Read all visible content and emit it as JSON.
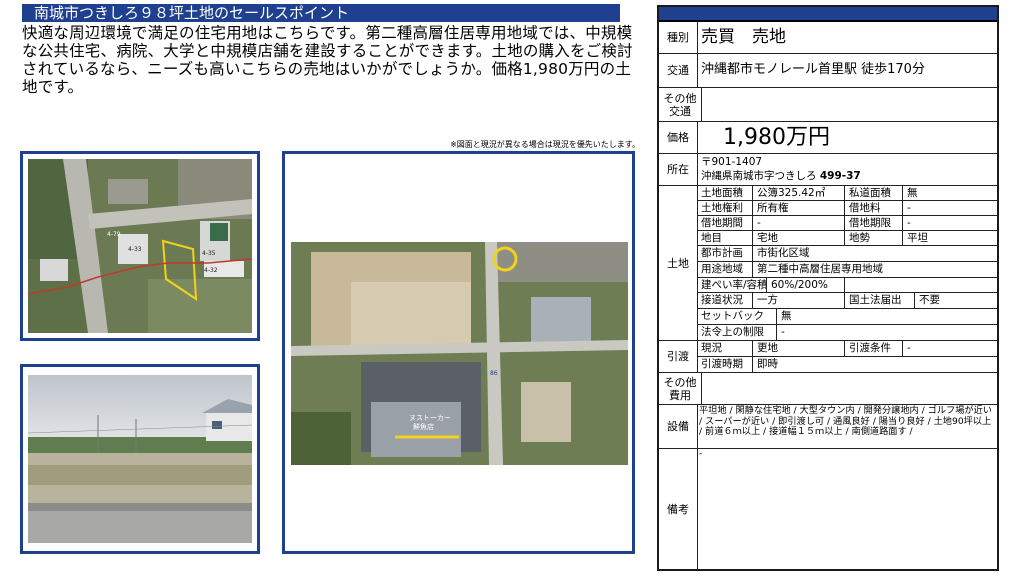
{
  "header": {
    "title": "南城市つきしろ９８坪土地のセールスポイント"
  },
  "description": "快適な周辺環境で満足の住宅用地はこちらです。第二種高層住居専用地域では、中規模な公共住宅、病院、大学と中規模店舗を建設することができます。土地の購入をご検討されているなら、ニーズも高いこちらの売地はいかがでしょうか。価格1,980万円の土地です。",
  "notice": "※図面と現況が異なる場合は現況を優先いたします。",
  "images": {
    "map_labels": [
      "4-79",
      "4-33",
      "4-35",
      "4-32"
    ],
    "aerial_labels": [
      "ヌストーカー",
      "鮮魚店"
    ],
    "aerial_road_number": "86"
  },
  "spec": {
    "type_label": "種別",
    "type_value": "売買　売地",
    "transport_label": "交通",
    "transport_value": "沖縄都市モノレール首里駅 徒歩170分",
    "other_transport_label": "その他交通",
    "other_transport_value": "",
    "price_label": "価格",
    "price_value": "1,980万円",
    "address_label": "所在",
    "postal": "〒901-1407",
    "address": "沖縄県南城市字つきしろ",
    "address_number": "499-37",
    "land_label": "土地",
    "land_area_label": "土地面積",
    "land_area_value": "公簿325.42㎡",
    "private_road_label": "私道面積",
    "private_road_value": "無",
    "land_right_label": "土地権利",
    "land_right_value": "所有権",
    "lease_fee_label": "借地料",
    "lease_fee_value": "-",
    "lease_period_label": "借地期間",
    "lease_period_value": "-",
    "lease_limit_label": "借地期限",
    "lease_limit_value": "-",
    "category_label": "地目",
    "category_value": "宅地",
    "terrain_label": "地勢",
    "terrain_value": "平坦",
    "city_plan_label": "都市計画",
    "city_plan_value": "市街化区域",
    "zoning_label": "用途地域",
    "zoning_value": "第二種中高層住居専用地域",
    "ratio_label": "建ぺい率/容積率",
    "ratio_value": "60%/200%",
    "road_label": "接道状況",
    "road_value": "一方",
    "notification_label": "国土法届出",
    "notification_value": "不要",
    "setback_label": "セットバック",
    "setback_value": "無",
    "legal_label": "法令上の制限",
    "legal_value": "-",
    "handover_label": "引渡",
    "status_label": "現況",
    "status_value": "更地",
    "condition_label": "引渡条件",
    "condition_value": "-",
    "timing_label": "引渡時期",
    "timing_value": "即時",
    "other_cost_label": "その他費用",
    "other_cost_value": "",
    "equipment_label": "設備",
    "equipment_value": "平坦地 / 閑静な住宅地 / 大型タウン内 / 開発分譲地内 / ゴルフ場が近い / スーパーが近い / 即引渡し可 / 通風良好 / 陽当り良好 / 土地90坪以上 / 前道６ｍ以上 / 接道幅１５ｍ以上 / 南側道路面す /",
    "remarks_label": "備考",
    "remarks_value": "-"
  },
  "colors": {
    "brand_blue": "#1f3f8f",
    "highlight_yellow": "#f2d21a"
  }
}
